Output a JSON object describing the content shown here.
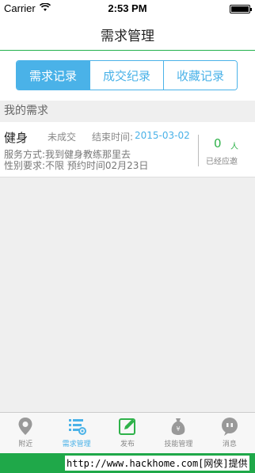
{
  "status_bar": {
    "carrier": "Carrier",
    "time": "2:53 PM"
  },
  "nav": {
    "title": "需求管理"
  },
  "segments": [
    {
      "label": "需求记录",
      "active": true
    },
    {
      "label": "成交纪录",
      "active": false
    },
    {
      "label": "收藏记录",
      "active": false
    }
  ],
  "section": {
    "title": "我的需求"
  },
  "request": {
    "title": "健身",
    "status": "未成交",
    "end_label": "结束时间:",
    "end_date": "2015-03-02",
    "service": "服务方式:我到健身教练那里去",
    "gender": "性别要求:不限  预约时间02月23日",
    "count": "0",
    "count_unit": "人",
    "count_label": "已经应邀"
  },
  "tabs": [
    {
      "label": "附近",
      "icon": "location-pin-icon"
    },
    {
      "label": "需求管理",
      "icon": "list-manage-icon"
    },
    {
      "label": "发布",
      "icon": "edit-publish-icon"
    },
    {
      "label": "技能管理",
      "icon": "skill-bag-icon"
    },
    {
      "label": "消息",
      "icon": "message-bubble-icon"
    }
  ],
  "watermark": {
    "text": "http://www.hackhome.com[网侠]提供"
  },
  "colors": {
    "accent_blue": "#4ab2e8",
    "green": "#22b14c",
    "count_green": "#2fb24a"
  }
}
